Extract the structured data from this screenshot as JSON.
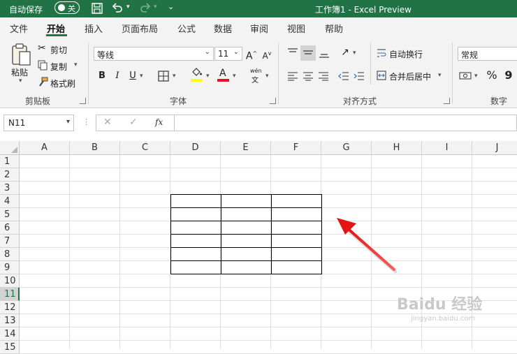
{
  "titlebar": {
    "autosave_label": "自动保存",
    "autosave_state": "关",
    "title": "工作簿1  -  Excel Preview",
    "bg_color": "#217346"
  },
  "menu": {
    "tabs": [
      {
        "label": "文件"
      },
      {
        "label": "开始",
        "active": true
      },
      {
        "label": "插入"
      },
      {
        "label": "页面布局"
      },
      {
        "label": "公式"
      },
      {
        "label": "数据"
      },
      {
        "label": "审阅"
      },
      {
        "label": "视图"
      },
      {
        "label": "帮助"
      }
    ]
  },
  "ribbon": {
    "clipboard": {
      "paste": "粘贴",
      "cut": "剪切",
      "copy": "复制",
      "format_painter": "格式刷",
      "group_label": "剪贴板"
    },
    "font": {
      "font_name": "等线",
      "font_size": "11",
      "bold": "B",
      "italic": "I",
      "underline": "U",
      "phonetic_top": "wén",
      "phonetic_bottom": "文",
      "group_label": "字体",
      "highlight_color": "#ffff00",
      "font_color": "#e81123"
    },
    "alignment": {
      "wrap_text": "自动换行",
      "merge_center": "合并后居中",
      "group_label": "对齐方式"
    },
    "number": {
      "format": "常规",
      "percent": "%",
      "comma": "9",
      "group_label": "数字"
    }
  },
  "formula_bar": {
    "name_box": "N11",
    "fx": "fx",
    "formula": ""
  },
  "sheet": {
    "columns": [
      "A",
      "B",
      "C",
      "D",
      "E",
      "F",
      "G",
      "H",
      "I",
      "J"
    ],
    "rows": [
      "1",
      "2",
      "3",
      "4",
      "5",
      "6",
      "7",
      "8",
      "9",
      "10",
      "11",
      "12",
      "13",
      "14",
      "15"
    ],
    "active_row": "11",
    "bordered_range": "D4:F9"
  },
  "watermark": {
    "brand": "Baidu 经验",
    "url": "jingyan.baidu.com"
  }
}
